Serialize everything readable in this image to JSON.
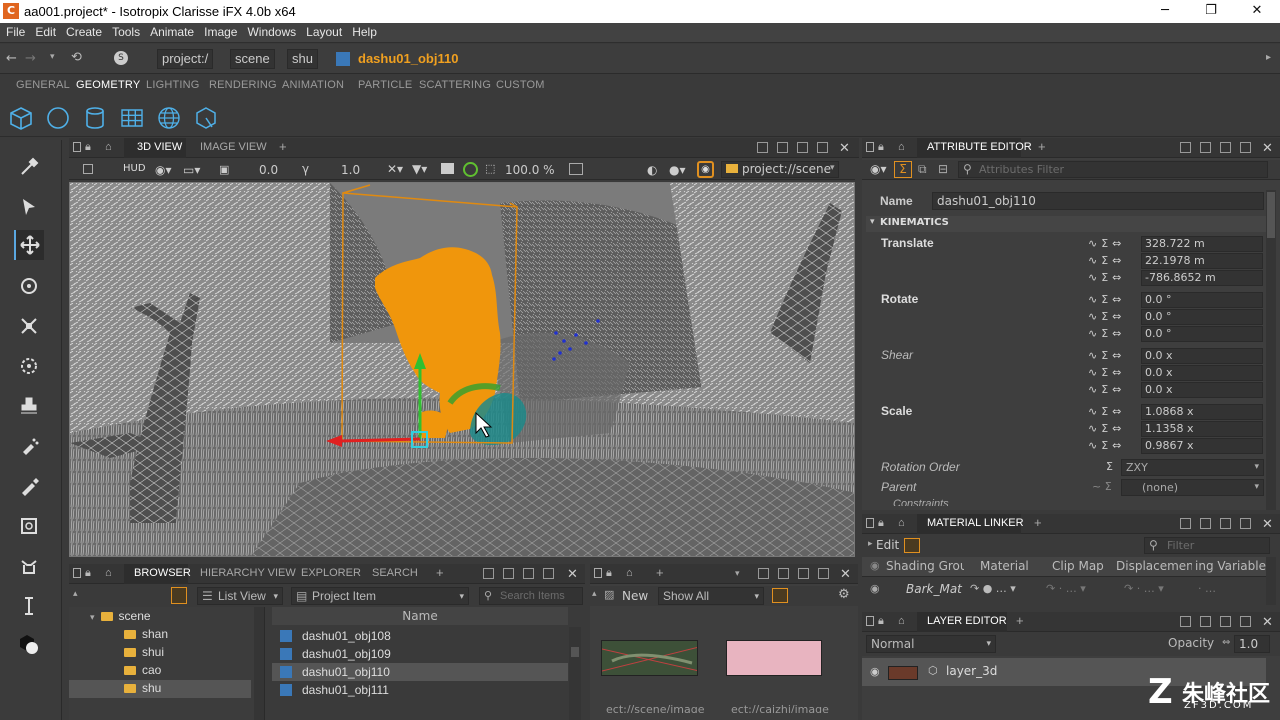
{
  "window": {
    "title": "aa001.project* - Isotropix Clarisse iFX 4.0b x64",
    "min": "─",
    "max": "❐",
    "close": "✕"
  },
  "menu": [
    "File",
    "Edit",
    "Create",
    "Tools",
    "Animate",
    "Image",
    "Windows",
    "Layout",
    "Help"
  ],
  "path": {
    "segments": [
      "project:/",
      "scene",
      "shu"
    ],
    "current": "dashu01_obj110"
  },
  "shelf_tabs": [
    "GENERAL",
    "GEOMETRY",
    "LIGHTING",
    "RENDERING",
    "ANIMATION",
    "PARTICLE",
    "SCATTERING",
    "CUSTOM"
  ],
  "shelf_active": "GEOMETRY",
  "view_tabs": {
    "view3d": "3D VIEW",
    "image": "IMAGE VIEW",
    "add": "+"
  },
  "view_toolbar": {
    "hud": "HUD",
    "val1": "0.0",
    "val2": "1.0",
    "zoom": "100.0 %",
    "context": "project://scene"
  },
  "attr": {
    "title": "ATTRIBUTE EDITOR",
    "filter_placeholder": "Attributes Filter",
    "name_label": "Name",
    "name_value": "dashu01_obj110",
    "section": "KINEMATICS",
    "translate_label": "Translate",
    "translate": [
      "328.722 m",
      "22.1978 m",
      "-786.8652 m"
    ],
    "rotate_label": "Rotate",
    "rotate": [
      "0.0 °",
      "0.0 °",
      "0.0 °"
    ],
    "shear_label": "Shear",
    "shear": [
      "0.0 x",
      "0.0 x",
      "0.0 x"
    ],
    "scale_label": "Scale",
    "scale": [
      "1.0868 x",
      "1.1358 x",
      "0.9867 x"
    ],
    "rotation_order_label": "Rotation Order",
    "rotation_order": "ZXY",
    "parent_label": "Parent",
    "parent": "(none)",
    "constraints": "Constraints"
  },
  "material": {
    "title": "MATERIAL LINKER",
    "edit": "Edit",
    "filter": "Filter",
    "cols": [
      "Shading Group",
      "Material",
      "Clip Map",
      "Displacement",
      "Shading Variable"
    ],
    "row_material": "Bark_Mat"
  },
  "layer": {
    "title": "LAYER EDITOR",
    "mode": "Normal",
    "opacity_label": "Opacity",
    "opacity": "1.0",
    "layer": "layer_3d"
  },
  "browser": {
    "tabs": [
      "BROWSER",
      "HIERARCHY VIEW",
      "EXPLORER",
      "SEARCH"
    ],
    "list_view": "List View",
    "project_item": "Project Item",
    "search_placeholder": "Search Items",
    "col_name": "Name",
    "tree": [
      "scene",
      "shan",
      "shui",
      "cao",
      "shu"
    ],
    "items": [
      "dashu01_obj108",
      "dashu01_obj109",
      "dashu01_obj110",
      "dashu01_obj111"
    ]
  },
  "images": {
    "new": "New",
    "show": "Show All",
    "cap1": "ect://scene/image",
    "cap2": "ect://caizhi/image"
  },
  "watermark": {
    "cn": "朱峰社区",
    "url": "ZF3D.COM"
  }
}
